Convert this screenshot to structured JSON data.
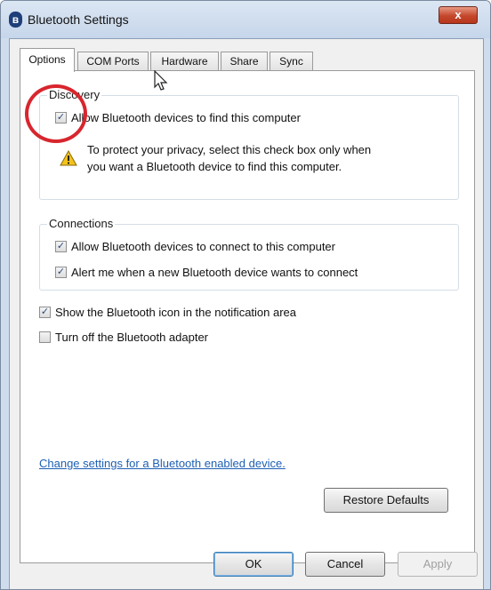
{
  "window": {
    "title": "Bluetooth Settings",
    "title_icon": "bluetooth-icon",
    "close_glyph": "x"
  },
  "tabs": [
    {
      "label": "Options",
      "active": true
    },
    {
      "label": "COM Ports",
      "active": false
    },
    {
      "label": "Hardware",
      "active": false
    },
    {
      "label": "Share",
      "active": false
    },
    {
      "label": "Sync",
      "active": false
    }
  ],
  "discovery": {
    "title": "Discovery",
    "allow_find": {
      "label": "Allow Bluetooth devices to find this computer",
      "checked": true
    },
    "warning_icon": "warning-icon",
    "warning_line1": "To protect your privacy, select this check box only when",
    "warning_line2": "you want a Bluetooth device to find this computer."
  },
  "connections": {
    "title": "Connections",
    "allow_connect": {
      "label": "Allow Bluetooth devices to connect to this computer",
      "checked": true
    },
    "alert_new": {
      "label": "Alert me when a new Bluetooth device wants to connect",
      "checked": true
    }
  },
  "options": {
    "show_icon": {
      "label": "Show the Bluetooth icon in the notification area",
      "checked": true
    },
    "turn_off": {
      "label": "Turn off the Bluetooth adapter",
      "checked": false
    }
  },
  "link": {
    "label": "Change settings for a Bluetooth enabled device."
  },
  "buttons": {
    "restore": "Restore Defaults",
    "ok": "OK",
    "cancel": "Cancel",
    "apply": "Apply"
  },
  "colors": {
    "annotation": "#d8262e",
    "link": "#1e5fb4",
    "close": "#c4472c"
  }
}
